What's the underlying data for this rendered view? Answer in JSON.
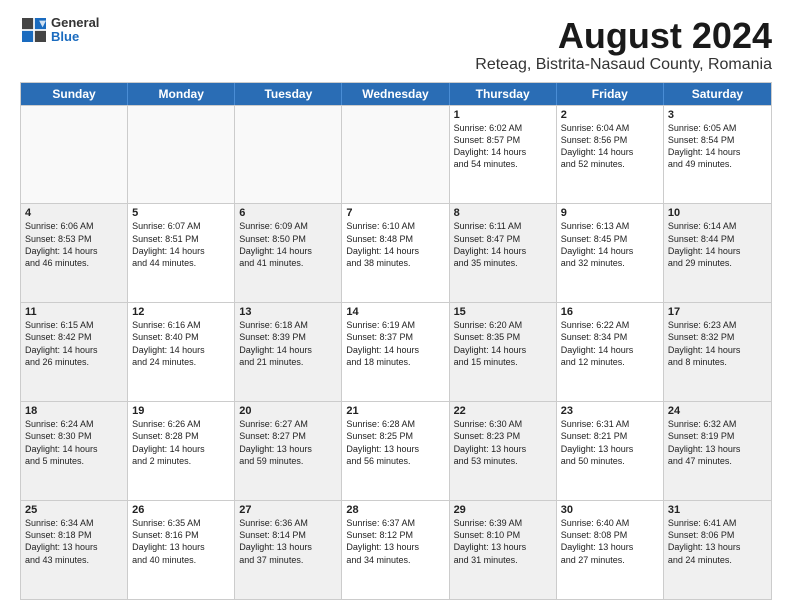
{
  "header": {
    "logo_general": "General",
    "logo_blue": "Blue",
    "main_title": "August 2024",
    "sub_title": "Reteag, Bistrita-Nasaud County, Romania"
  },
  "weekdays": [
    "Sunday",
    "Monday",
    "Tuesday",
    "Wednesday",
    "Thursday",
    "Friday",
    "Saturday"
  ],
  "rows": [
    [
      {
        "day": "",
        "text": "",
        "empty": true
      },
      {
        "day": "",
        "text": "",
        "empty": true
      },
      {
        "day": "",
        "text": "",
        "empty": true
      },
      {
        "day": "",
        "text": "",
        "empty": true
      },
      {
        "day": "1",
        "text": "Sunrise: 6:02 AM\nSunset: 8:57 PM\nDaylight: 14 hours\nand 54 minutes."
      },
      {
        "day": "2",
        "text": "Sunrise: 6:04 AM\nSunset: 8:56 PM\nDaylight: 14 hours\nand 52 minutes."
      },
      {
        "day": "3",
        "text": "Sunrise: 6:05 AM\nSunset: 8:54 PM\nDaylight: 14 hours\nand 49 minutes."
      }
    ],
    [
      {
        "day": "4",
        "text": "Sunrise: 6:06 AM\nSunset: 8:53 PM\nDaylight: 14 hours\nand 46 minutes.",
        "shaded": true
      },
      {
        "day": "5",
        "text": "Sunrise: 6:07 AM\nSunset: 8:51 PM\nDaylight: 14 hours\nand 44 minutes."
      },
      {
        "day": "6",
        "text": "Sunrise: 6:09 AM\nSunset: 8:50 PM\nDaylight: 14 hours\nand 41 minutes.",
        "shaded": true
      },
      {
        "day": "7",
        "text": "Sunrise: 6:10 AM\nSunset: 8:48 PM\nDaylight: 14 hours\nand 38 minutes."
      },
      {
        "day": "8",
        "text": "Sunrise: 6:11 AM\nSunset: 8:47 PM\nDaylight: 14 hours\nand 35 minutes.",
        "shaded": true
      },
      {
        "day": "9",
        "text": "Sunrise: 6:13 AM\nSunset: 8:45 PM\nDaylight: 14 hours\nand 32 minutes."
      },
      {
        "day": "10",
        "text": "Sunrise: 6:14 AM\nSunset: 8:44 PM\nDaylight: 14 hours\nand 29 minutes.",
        "shaded": true
      }
    ],
    [
      {
        "day": "11",
        "text": "Sunrise: 6:15 AM\nSunset: 8:42 PM\nDaylight: 14 hours\nand 26 minutes.",
        "shaded": true
      },
      {
        "day": "12",
        "text": "Sunrise: 6:16 AM\nSunset: 8:40 PM\nDaylight: 14 hours\nand 24 minutes."
      },
      {
        "day": "13",
        "text": "Sunrise: 6:18 AM\nSunset: 8:39 PM\nDaylight: 14 hours\nand 21 minutes.",
        "shaded": true
      },
      {
        "day": "14",
        "text": "Sunrise: 6:19 AM\nSunset: 8:37 PM\nDaylight: 14 hours\nand 18 minutes."
      },
      {
        "day": "15",
        "text": "Sunrise: 6:20 AM\nSunset: 8:35 PM\nDaylight: 14 hours\nand 15 minutes.",
        "shaded": true
      },
      {
        "day": "16",
        "text": "Sunrise: 6:22 AM\nSunset: 8:34 PM\nDaylight: 14 hours\nand 12 minutes."
      },
      {
        "day": "17",
        "text": "Sunrise: 6:23 AM\nSunset: 8:32 PM\nDaylight: 14 hours\nand 8 minutes.",
        "shaded": true
      }
    ],
    [
      {
        "day": "18",
        "text": "Sunrise: 6:24 AM\nSunset: 8:30 PM\nDaylight: 14 hours\nand 5 minutes.",
        "shaded": true
      },
      {
        "day": "19",
        "text": "Sunrise: 6:26 AM\nSunset: 8:28 PM\nDaylight: 14 hours\nand 2 minutes."
      },
      {
        "day": "20",
        "text": "Sunrise: 6:27 AM\nSunset: 8:27 PM\nDaylight: 13 hours\nand 59 minutes.",
        "shaded": true
      },
      {
        "day": "21",
        "text": "Sunrise: 6:28 AM\nSunset: 8:25 PM\nDaylight: 13 hours\nand 56 minutes."
      },
      {
        "day": "22",
        "text": "Sunrise: 6:30 AM\nSunset: 8:23 PM\nDaylight: 13 hours\nand 53 minutes.",
        "shaded": true
      },
      {
        "day": "23",
        "text": "Sunrise: 6:31 AM\nSunset: 8:21 PM\nDaylight: 13 hours\nand 50 minutes."
      },
      {
        "day": "24",
        "text": "Sunrise: 6:32 AM\nSunset: 8:19 PM\nDaylight: 13 hours\nand 47 minutes.",
        "shaded": true
      }
    ],
    [
      {
        "day": "25",
        "text": "Sunrise: 6:34 AM\nSunset: 8:18 PM\nDaylight: 13 hours\nand 43 minutes.",
        "shaded": true
      },
      {
        "day": "26",
        "text": "Sunrise: 6:35 AM\nSunset: 8:16 PM\nDaylight: 13 hours\nand 40 minutes."
      },
      {
        "day": "27",
        "text": "Sunrise: 6:36 AM\nSunset: 8:14 PM\nDaylight: 13 hours\nand 37 minutes.",
        "shaded": true
      },
      {
        "day": "28",
        "text": "Sunrise: 6:37 AM\nSunset: 8:12 PM\nDaylight: 13 hours\nand 34 minutes."
      },
      {
        "day": "29",
        "text": "Sunrise: 6:39 AM\nSunset: 8:10 PM\nDaylight: 13 hours\nand 31 minutes.",
        "shaded": true
      },
      {
        "day": "30",
        "text": "Sunrise: 6:40 AM\nSunset: 8:08 PM\nDaylight: 13 hours\nand 27 minutes."
      },
      {
        "day": "31",
        "text": "Sunrise: 6:41 AM\nSunset: 8:06 PM\nDaylight: 13 hours\nand 24 minutes.",
        "shaded": true
      }
    ]
  ]
}
